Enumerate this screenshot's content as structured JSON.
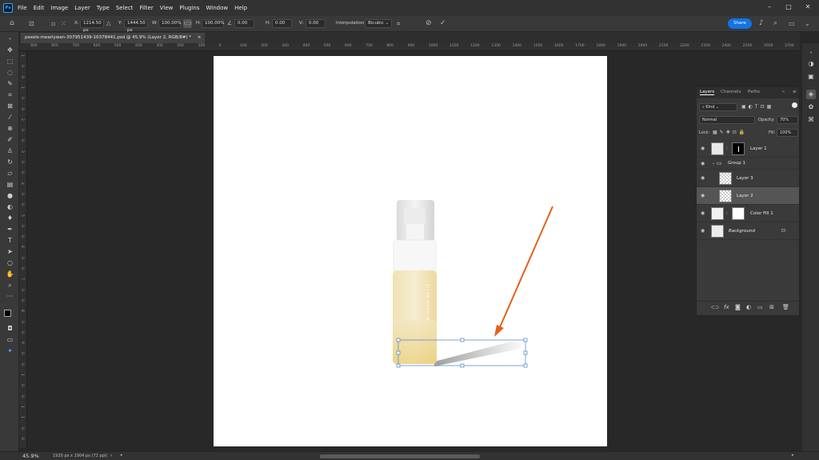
{
  "app": {
    "logo_text": "Ps"
  },
  "menu": [
    "File",
    "Edit",
    "Image",
    "Layer",
    "Type",
    "Select",
    "Filter",
    "View",
    "Plugins",
    "Window",
    "Help"
  ],
  "options": {
    "x_label": "X:",
    "x_value": "1214.50 px",
    "y_label": "Y:",
    "y_value": "1444.50 px",
    "w_label": "W:",
    "w_value": "100.00%",
    "h_label": "H:",
    "h_value": "100.00%",
    "angle_value": "0.00",
    "hskew_label": "H:",
    "hskew_value": "0.00",
    "vskew_label": "V:",
    "vskew_value": "0.00",
    "interp_label": "Interpolation:",
    "interp_value": "Bicubic",
    "share_label": "Share"
  },
  "document": {
    "tab_title": "pexels-mearlywan-307951439-16378441.psd @ 45.9% (Layer 2, RGB/8#) *",
    "tab_close": "×"
  },
  "ruler_h": [
    "900",
    "800",
    "700",
    "600",
    "500",
    "400",
    "300",
    "200",
    "100",
    "0",
    "100",
    "200",
    "300",
    "400",
    "500",
    "600",
    "700",
    "800",
    "900",
    "1000",
    "1100",
    "1200",
    "1300",
    "1400",
    "1500",
    "1600",
    "1700",
    "1800",
    "1900",
    "2000",
    "2100",
    "2200",
    "2300",
    "2400",
    "2500",
    "2600",
    "2700",
    "2800"
  ],
  "ruler_v": [
    "1",
    "0",
    "0",
    "1",
    "0",
    "0",
    "2",
    "0",
    "0",
    "3",
    "0",
    "0",
    "4",
    "0",
    "0",
    "5",
    "0",
    "0",
    "6",
    "0",
    "0",
    "7",
    "0",
    "0",
    "8",
    "0",
    "0",
    "9",
    "0",
    "0",
    "1",
    "0",
    "0",
    "1",
    "1",
    "0",
    "0"
  ],
  "product": {
    "label_text": "V I T A M I N S E R U M"
  },
  "layers_panel": {
    "tabs": [
      "Layers",
      "Channels",
      "Paths"
    ],
    "kind_label": "Kind",
    "blend_mode": "Normal",
    "opacity_label": "Opacity:",
    "opacity_value": "70%",
    "lock_label": "Lock:",
    "fill_label": "Fill:",
    "fill_value": "100%",
    "layers": [
      {
        "name": "Layer 1"
      },
      {
        "name": "Group 1"
      },
      {
        "name": "Layer 3"
      },
      {
        "name": "Layer 2"
      },
      {
        "name": "Color Fill 1"
      },
      {
        "name": "Background"
      }
    ]
  },
  "status": {
    "zoom": "45.9%",
    "doc_info": "1920 px x 1904 px (72 ppi)"
  },
  "colors": {
    "accent": "#1473e6",
    "arrow": "#e3611c",
    "selection_bg": "#555555"
  }
}
